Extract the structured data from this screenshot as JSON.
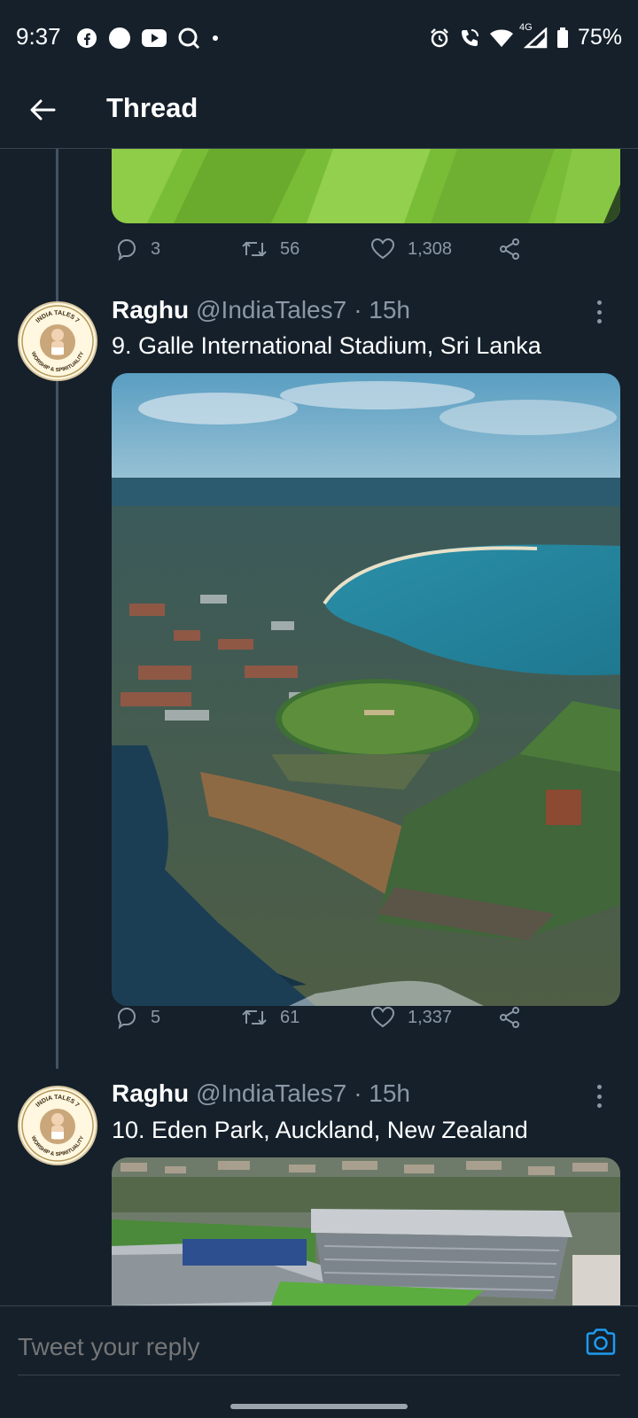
{
  "status_bar": {
    "time": "9:37",
    "network": "4G",
    "battery": "75%",
    "left_icons": [
      "facebook-icon",
      "circle-icon",
      "youtube-icon",
      "search-app-icon",
      "dot-icon"
    ],
    "right_icons": [
      "alarm-icon",
      "wifi-call-icon",
      "wifi-icon",
      "signal-icon",
      "battery-icon"
    ]
  },
  "header": {
    "title": "Thread"
  },
  "tweets": [
    {
      "replies": "3",
      "retweets": "56",
      "likes": "1,308"
    },
    {
      "name": "Raghu",
      "handle": "@IndiaTales7",
      "time": "· 15h",
      "text": "9. Galle International Stadium, Sri Lanka",
      "replies": "5",
      "retweets": "61",
      "likes": "1,337"
    },
    {
      "name": "Raghu",
      "handle": "@IndiaTales7",
      "time": "· 15h",
      "text": "10. Eden Park, Auckland, New Zealand"
    }
  ],
  "avatar_text": {
    "top": "INDIA TALES 7",
    "bottom": "WORSHIP & SPIRITUALITY"
  },
  "reply": {
    "placeholder": "Tweet your reply"
  },
  "colors": {
    "background": "#15202b",
    "accent": "#1d9bf0",
    "muted": "#8b98a5",
    "divider": "#38444d"
  }
}
